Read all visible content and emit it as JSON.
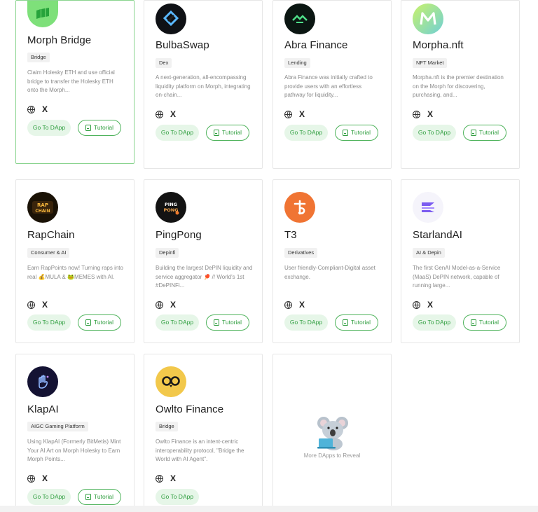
{
  "cards": [
    {
      "name": "Morph Bridge",
      "tag": "Bridge",
      "description": "Claim Holesky ETH and use official bridge to transfer the Holesky ETH onto the Morph...",
      "go_label": "Go To DApp",
      "tutorial_label": "Tutorial",
      "logo_icon": "morph-bridge-logo-icon",
      "logo_color": "#7ee07a"
    },
    {
      "name": "BulbaSwap",
      "tag": "Dex",
      "description": "A next-generation, all-encompassing liquidity platform on Morph, integrating on-chain...",
      "go_label": "Go To DApp",
      "tutorial_label": "Tutorial",
      "logo_icon": "bulbaswap-logo-icon",
      "logo_color": "#0f1115"
    },
    {
      "name": "Abra Finance",
      "tag": "Lending",
      "description": "Abra Finance was initially crafted to provide users with an effortless pathway for liquidity...",
      "go_label": "Go To DApp",
      "tutorial_label": "Tutorial",
      "logo_icon": "abra-finance-logo-icon",
      "logo_color": "#0b1612"
    },
    {
      "name": "Morpha.nft",
      "tag": "NFT Market",
      "description": "Morpha.nft is the premier destination on the Morph for discovering, purchasing, and...",
      "go_label": "Go To DApp",
      "tutorial_label": "Tutorial",
      "logo_icon": "morpha-nft-logo-icon",
      "logo_color": "#8fe0a4"
    },
    {
      "name": "RapChain",
      "tag": "Consumer & AI",
      "description": "Earn RapPoints now! Turning raps into real 💰MULA & 🐸MEMES with AI.",
      "go_label": "Go To DApp",
      "tutorial_label": "Tutorial",
      "logo_icon": "rapchain-logo-icon",
      "logo_color": "#1a1206"
    },
    {
      "name": "PingPong",
      "tag": "Depinfi",
      "description": "Building the largest DePIN liquidity and service aggregator 🏓 // World's 1st #DePINFi...",
      "go_label": "Go To DApp",
      "tutorial_label": "Tutorial",
      "logo_icon": "pingpong-logo-icon",
      "logo_color": "#131313"
    },
    {
      "name": "T3",
      "tag": "Derivatives",
      "description": "User friendly-Compliant-Digital asset exchange.",
      "go_label": "Go To DApp",
      "tutorial_label": "Tutorial",
      "logo_icon": "t3-logo-icon",
      "logo_color": "#f07433"
    },
    {
      "name": "StarlandAI",
      "tag": "AI & Depin",
      "description": "The first GenAI Model-as-a-Service (MaaS) DePIN network, capable of running large...",
      "go_label": "Go To DApp",
      "tutorial_label": "Tutorial",
      "logo_icon": "starlandai-logo-icon",
      "logo_color": "#ffffff"
    },
    {
      "name": "KlapAI",
      "tag": "AIGC Gaming Platform",
      "description": "Using KlapAI (Formerly BitMetis) Mint Your AI Art on Morph Holesky to Earn Morph Points...",
      "go_label": "Go To DApp",
      "tutorial_label": "Tutorial",
      "logo_icon": "klapai-logo-icon",
      "logo_color": "#141233"
    },
    {
      "name": "Owlto Finance",
      "tag": "Bridge",
      "description": "Owlto Finance is an intent-centric interoperability protocol, \"Bridge the World with AI Agent\".",
      "go_label": "Go To DApp",
      "tutorial_label": "",
      "logo_icon": "owlto-finance-logo-icon",
      "logo_color": "#f2c84b"
    }
  ],
  "reveal": {
    "text": "More DApps to Reveal",
    "icon": "koala-laptop-icon"
  },
  "colors": {
    "accent": "#2f9e3f",
    "accent_bg": "#e6f6e8",
    "selected_border": "#8ad48f"
  }
}
